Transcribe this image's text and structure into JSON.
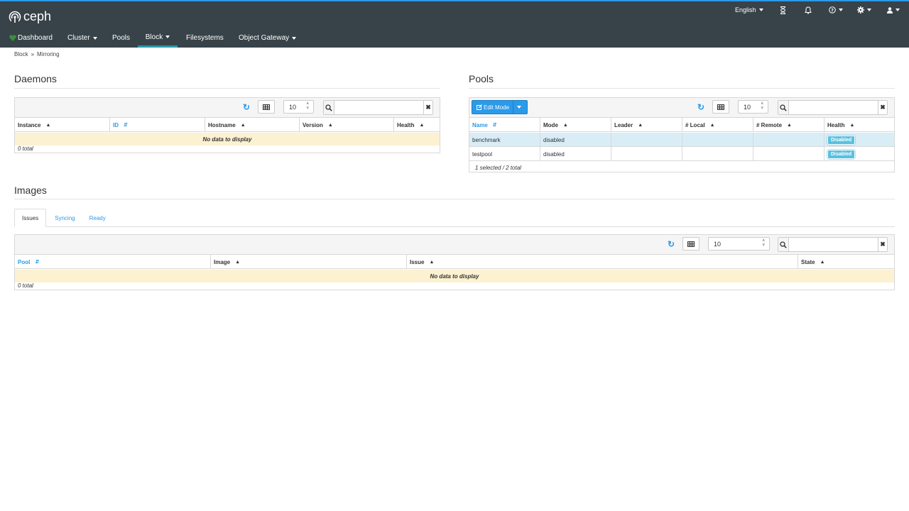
{
  "app": {
    "name": "ceph"
  },
  "topbar": {
    "language": "English",
    "icons": [
      "hourglass-icon",
      "bell-icon",
      "help-icon",
      "gear-icon",
      "user-icon"
    ]
  },
  "nav": {
    "items": [
      {
        "label": "Dashboard"
      },
      {
        "label": "Cluster"
      },
      {
        "label": "Pools"
      },
      {
        "label": "Block"
      },
      {
        "label": "Filesystems"
      },
      {
        "label": "Object Gateway"
      }
    ],
    "active": "Block"
  },
  "breadcrumb": [
    "Block",
    "Mirroring"
  ],
  "daemons": {
    "title": "Daemons",
    "limit": "10",
    "columns": [
      "Instance",
      "ID",
      "Hostname",
      "Version",
      "Health"
    ],
    "sorted_column": "ID",
    "empty_text": "No data to display",
    "footer": "0 total"
  },
  "pools": {
    "title": "Pools",
    "edit_mode_label": "Edit Mode",
    "limit": "10",
    "columns": [
      "Name",
      "Mode",
      "Leader",
      "# Local",
      "# Remote",
      "Health"
    ],
    "sorted_column": "Name",
    "rows": [
      {
        "name": "benchmark",
        "mode": "disabled",
        "leader": "",
        "local": "",
        "remote": "",
        "health": "Disabled",
        "selected": true
      },
      {
        "name": "testpool",
        "mode": "disabled",
        "leader": "",
        "local": "",
        "remote": "",
        "health": "Disabled",
        "selected": false
      }
    ],
    "footer": "1 selected / 2 total"
  },
  "images": {
    "title": "Images",
    "tabs": [
      "Issues",
      "Syncing",
      "Ready"
    ],
    "active_tab": "Issues",
    "limit": "10",
    "columns": [
      "Pool",
      "Image",
      "Issue",
      "State"
    ],
    "sorted_column": "Pool",
    "empty_text": "No data to display",
    "footer": "0 total"
  },
  "colors": {
    "accent": "#2b9ae9",
    "topbar": "#374249",
    "badge": "#5bc0de",
    "empty_row": "#fcf1d0",
    "selected_row": "#d9edf7"
  }
}
